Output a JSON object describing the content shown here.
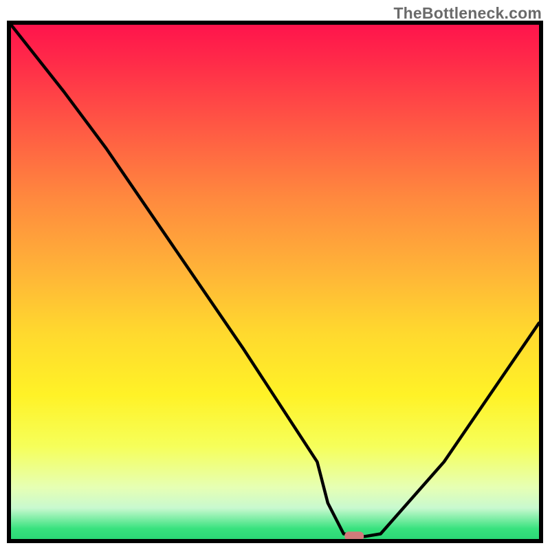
{
  "watermark": "TheBottleneck.com",
  "chart_data": {
    "type": "line",
    "title": "",
    "xlabel": "",
    "ylabel": "",
    "xlim": [
      0,
      100
    ],
    "ylim": [
      0,
      100
    ],
    "grid": false,
    "legend": false,
    "background": "red-yellow-green vertical gradient",
    "series": [
      {
        "name": "bottleneck-curve",
        "x": [
          0,
          10,
          18,
          30,
          44,
          58,
          60,
          63,
          67,
          70,
          82,
          100
        ],
        "y": [
          100,
          87,
          76,
          58,
          37,
          15,
          7,
          1,
          0.5,
          1,
          15,
          42
        ]
      }
    ],
    "marker": {
      "name": "optimal-point",
      "x": 65,
      "y": 0.5,
      "color": "#d07b7b"
    }
  },
  "colors": {
    "gradient_top": "#ff144c",
    "gradient_mid": "#ffd92e",
    "gradient_bottom": "#2bd876",
    "curve": "#000000",
    "marker": "#d07b7b",
    "frame": "#000000"
  }
}
